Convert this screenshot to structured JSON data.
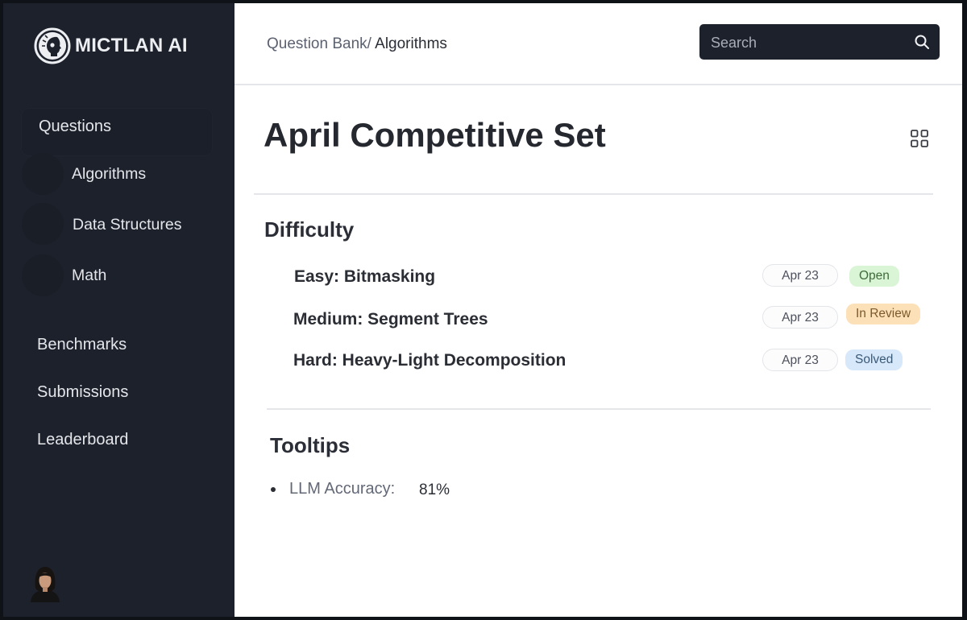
{
  "brand": {
    "name": "MICTLAN AI",
    "logo_icon": "skull-logo-icon"
  },
  "sidebar": {
    "questions_label": "Questions",
    "sub_items": [
      {
        "label": "Algorithms"
      },
      {
        "label": "Data Structures"
      },
      {
        "label": "Math"
      }
    ],
    "items": [
      {
        "label": "Benchmarks"
      },
      {
        "label": "Submissions"
      },
      {
        "label": "Leaderboard"
      }
    ],
    "avatar_icon": "user-avatar"
  },
  "header": {
    "breadcrumb_root": "Question Bank/",
    "breadcrumb_current": "Algorithms",
    "search_placeholder": "Search",
    "search_icon": "search-icon"
  },
  "page": {
    "title": "April Competitive Set",
    "view_icon": "grid-icon"
  },
  "difficulty": {
    "heading": "Difficulty",
    "questions": [
      {
        "label": "Easy: Bitmasking",
        "date": "Apr 23",
        "status": "Open",
        "status_color": "#d9f5d6"
      },
      {
        "label": "Medium: Segment Trees",
        "date": "Apr 23",
        "status": "In Review",
        "status_color": "#fce0b8"
      },
      {
        "label": "Hard: Heavy-Light Decomposition",
        "date": "Apr 23",
        "status": "Solved",
        "status_color": "#d6e8fa"
      }
    ]
  },
  "tooltips": {
    "heading": "Tooltips",
    "items": [
      {
        "label": "LLM Accuracy:",
        "value": "81%"
      }
    ]
  },
  "colors": {
    "sidebar_bg": "#1d212c",
    "search_bg": "#1d212c",
    "page_bg": "#ffffff"
  }
}
